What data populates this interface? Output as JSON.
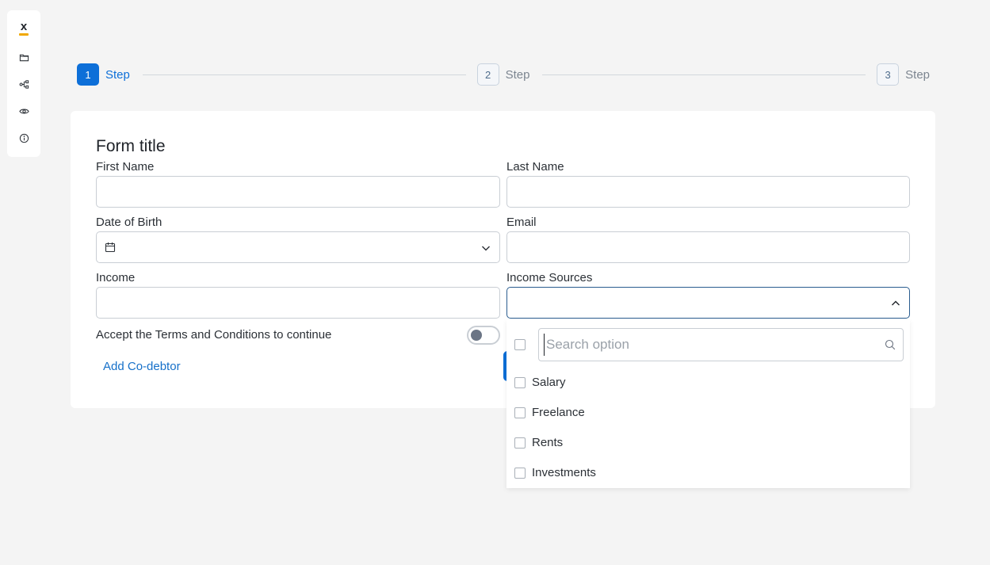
{
  "sidebar": {
    "logo": "x",
    "icons": [
      "folder-icon",
      "flow-icon",
      "eye-icon",
      "info-icon"
    ]
  },
  "stepper": {
    "steps": [
      {
        "number": "1",
        "label": "Step",
        "active": true
      },
      {
        "number": "2",
        "label": "Step",
        "active": false
      },
      {
        "number": "3",
        "label": "Step",
        "active": false
      }
    ]
  },
  "form": {
    "title": "Form title",
    "first_name": {
      "label": "First Name",
      "value": ""
    },
    "last_name": {
      "label": "Last Name",
      "value": ""
    },
    "date_of_birth": {
      "label": "Date of Birth",
      "value": ""
    },
    "email": {
      "label": "Email",
      "value": ""
    },
    "income": {
      "label": "Income",
      "value": ""
    },
    "income_sources": {
      "label": "Income Sources",
      "value": ""
    },
    "terms_label": "Accept the Terms and Conditions to continue",
    "terms_checked": false,
    "add_codebtor_label": "Add Co-debtor"
  },
  "dropdown": {
    "search_placeholder": "Search option",
    "options": [
      "Salary",
      "Freelance",
      "Rents",
      "Investments"
    ]
  },
  "colors": {
    "accent": "#0d6fd8",
    "link": "#1670c9",
    "logo_bar": "#f0a800"
  }
}
